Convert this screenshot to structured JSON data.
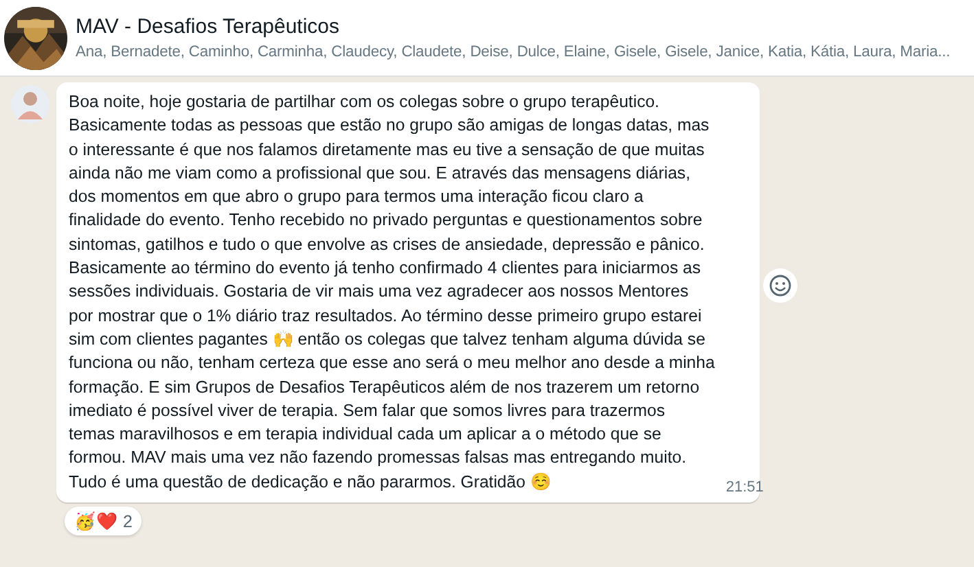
{
  "header": {
    "title": "MAV - Desafios Terapêuticos",
    "members": "Ana, Bernadete, Caminho, Carminha, Claudecy, Claudete, Deise, Dulce, Elaine, Gisele, Gisele, Janice, Katia, Kátia, Laura, Maria..."
  },
  "message": {
    "lines": [
      "Boa noite, hoje gostaria de partilhar com os colegas sobre o grupo terapêutico.",
      "Basicamente todas as pessoas que estão no grupo são amigas de longas datas, mas",
      "o interessante é que nos falamos diretamente mas eu tive a sensação de que muitas",
      "ainda não me viam como a profissional que sou. E através das mensagens diárias,",
      "dos momentos em que abro o grupo para termos uma interação ficou claro a",
      "finalidade do evento. Tenho recebido no privado perguntas e questionamentos sobre",
      "sintomas, gatilhos e tudo o que envolve as crises de ansiedade, depressão e pânico.",
      "Basicamente ao término do evento já tenho confirmado 4 clientes para iniciarmos as",
      "sessões individuais. Gostaria de vir mais uma vez agradecer aos nossos Mentores",
      "por mostrar que o 1% diário traz resultados. Ao término desse primeiro grupo estarei",
      "sim com clientes pagantes 🙌 então os colegas que talvez tenham alguma dúvida se",
      "funciona ou não, tenham certeza que esse ano será o meu melhor ano desde a minha",
      "formação. E sim Grupos de Desafios Terapêuticos além de nos trazerem um retorno",
      "imediato é possível viver de terapia. Sem falar que somos livres para trazermos",
      "temas maravilhosos e em terapia individual cada um aplicar a o método que se",
      "formou. MAV mais uma vez não fazendo promessas falsas mas entregando muito.",
      "Tudo é uma questão de dedicação e não pararmos. Gratidão ☺️"
    ],
    "time": "21:51",
    "reactions": {
      "emojis": "🥳❤️",
      "count": "2"
    }
  }
}
